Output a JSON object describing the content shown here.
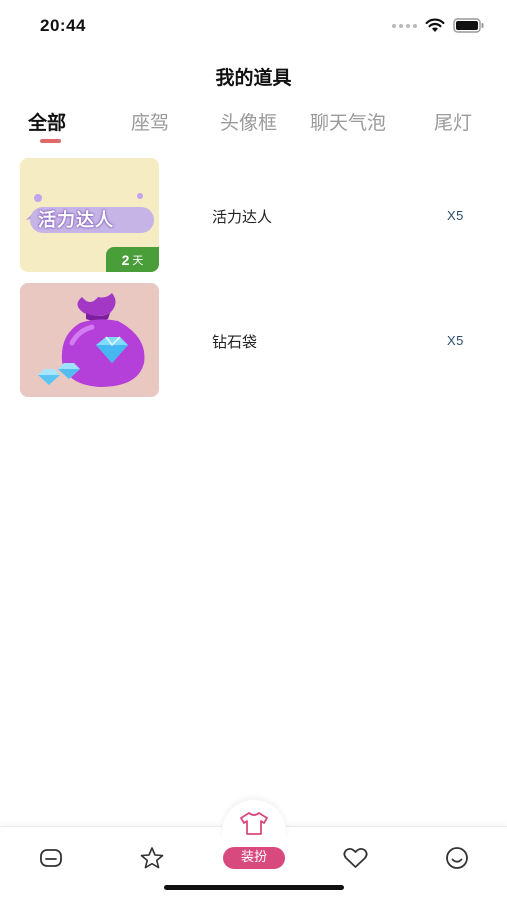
{
  "status_bar": {
    "time": "20:44"
  },
  "page": {
    "title": "我的道具"
  },
  "tabs": [
    {
      "label": "全部",
      "active": true
    },
    {
      "label": "座驾",
      "active": false
    },
    {
      "label": "头像框",
      "active": false
    },
    {
      "label": "聊天气泡",
      "active": false
    },
    {
      "label": "尾灯",
      "active": false
    }
  ],
  "items": [
    {
      "name": "活力达人",
      "count": "X5",
      "thumb_text": "活力达人",
      "days_num": "2",
      "days_unit": "天",
      "icon": "energy-badge-icon"
    },
    {
      "name": "钻石袋",
      "count": "X5",
      "icon": "diamond-bag-icon"
    }
  ],
  "bottom_nav": {
    "items": [
      {
        "icon": "home-icon"
      },
      {
        "icon": "star-icon"
      },
      {
        "icon": "shirt-icon",
        "label": "装扮",
        "active": true
      },
      {
        "icon": "heart-icon"
      },
      {
        "icon": "smile-icon"
      }
    ]
  },
  "colors": {
    "accent_tab": "#e06a6a",
    "dress_active": "#d84a7e",
    "days_badge": "#4a9e3a",
    "count_text": "#2d4e6e"
  }
}
